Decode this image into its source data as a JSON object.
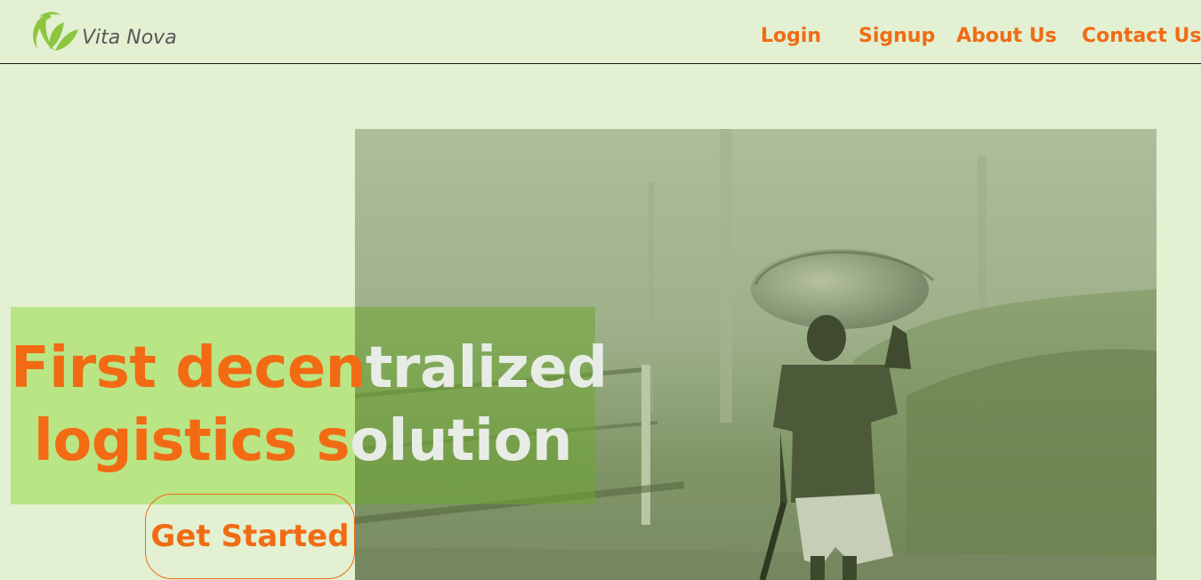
{
  "brand": {
    "name": "Vita Nova",
    "logo_icon": "leaf-icon",
    "logo_color": "#8cc63f"
  },
  "nav": {
    "login": "Login",
    "signup": "Signup",
    "about": "About Us",
    "contact": "Contact Us"
  },
  "hero": {
    "line1_orange": "First decen",
    "line1_light": "tralized",
    "line2_orange": "logistics s",
    "line2_light": "olution",
    "cta_label": "Get Started",
    "image_description_icon": "child-carrying-sack-photo"
  },
  "colors": {
    "accent": "#f06c14",
    "background": "#e3f0d2",
    "headline_box": "#b9e585"
  }
}
